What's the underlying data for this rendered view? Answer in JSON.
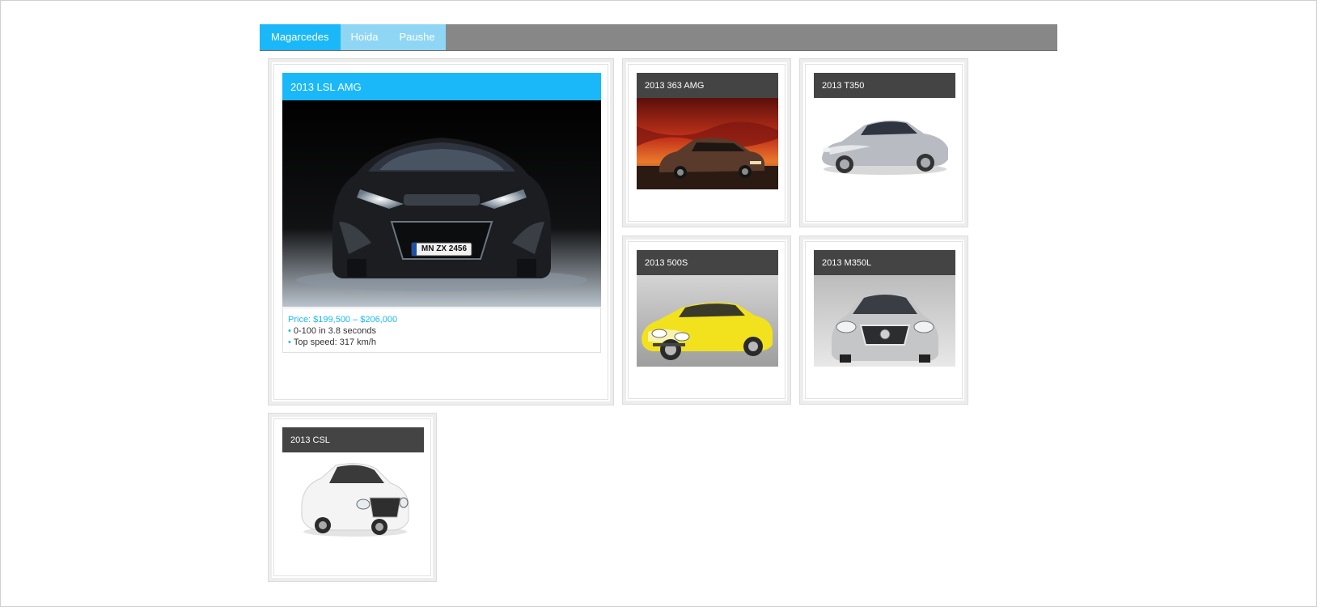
{
  "tabs": [
    {
      "label": "Magarcedes",
      "active": true
    },
    {
      "label": "Hoida",
      "active": false
    },
    {
      "label": "Paushe",
      "active": false
    }
  ],
  "featured": {
    "title": "2013 LSL AMG",
    "plate": "MN ZX 2456",
    "price": "Price: $199,500 – $206,000",
    "specs": [
      "0-100 in 3.8 seconds",
      "Top speed: 317 km/h"
    ]
  },
  "cars": [
    {
      "title": "2013 363 AMG",
      "color": "#5a3a2a"
    },
    {
      "title": "2013 T350",
      "color": "#b8bcc2"
    },
    {
      "title": "2013 500S",
      "color": "#f2e21e"
    },
    {
      "title": "2013 M350L",
      "color": "#c4c6c8"
    },
    {
      "title": "2013 CSL",
      "color": "#f4f4f4"
    }
  ],
  "colors": {
    "accent": "#1ab8f8",
    "tab_inactive": "#8fd6f5",
    "tabbar": "#878787",
    "card_header": "#444444"
  },
  "bullet_glyph": "•"
}
